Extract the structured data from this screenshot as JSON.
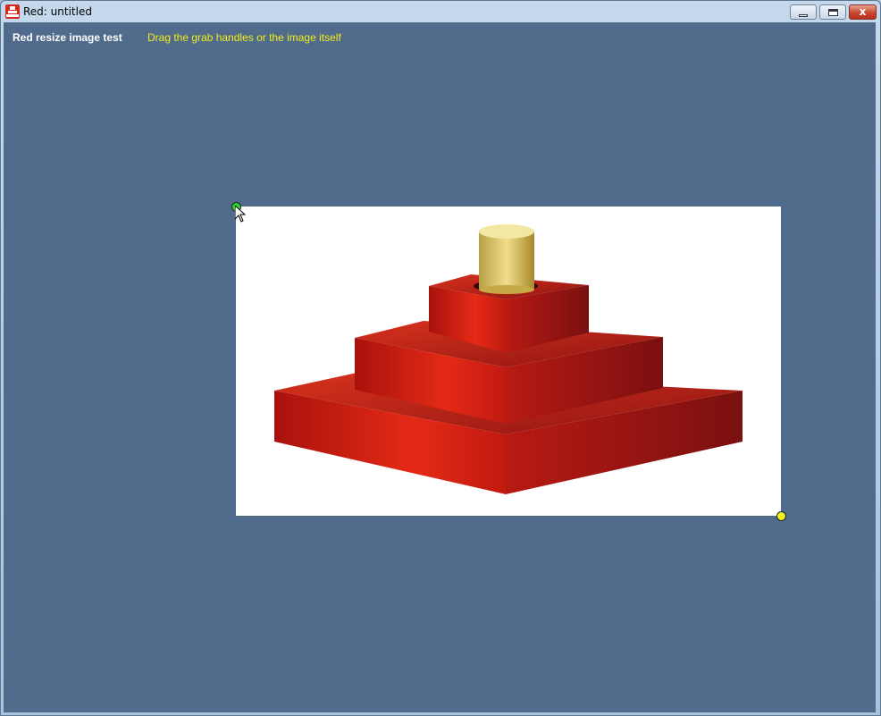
{
  "window": {
    "title": "Red: untitled",
    "app_icon": "red-logo-icon",
    "controls": [
      "minimize-icon",
      "restore-icon",
      "close-icon"
    ],
    "close_glyph": "x"
  },
  "content": {
    "heading": "Red resize image test",
    "hint": "Drag the grab handles or the image itself",
    "background_color": "#506b8b",
    "hint_color": "#f2ee1b"
  },
  "image": {
    "subject": "red stepped pyramid with wooden peg",
    "handle_start_color": "#2ad52a",
    "handle_end_color": "#f5f021"
  }
}
